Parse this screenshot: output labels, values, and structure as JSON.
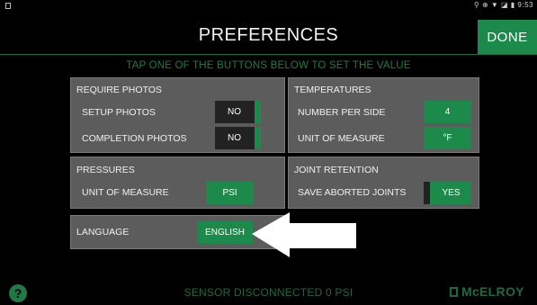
{
  "status_bar": {
    "right_text": "⚲ ⊕ ▼ ◪ ▮ 9:53"
  },
  "header": {
    "title": "PREFERENCES",
    "done_label": "DONE"
  },
  "instruction": "TAP ONE OF THE BUTTONS BELOW TO SET THE VALUE",
  "require_photos": {
    "title": "REQUIRE PHOTOS",
    "setup_label": "SETUP PHOTOS",
    "setup_value": "NO",
    "completion_label": "COMPLETION PHOTOS",
    "completion_value": "NO"
  },
  "temperatures": {
    "title": "TEMPERATURES",
    "number_label": "NUMBER PER SIDE",
    "number_value": "4",
    "unit_label": "UNIT OF MEASURE",
    "unit_value": "°F"
  },
  "pressures": {
    "title": "PRESSURES",
    "unit_label": "UNIT OF MEASURE",
    "unit_value": "PSI"
  },
  "joint_retention": {
    "title": "JOINT RETENTION",
    "save_label": "SAVE ABORTED JOINTS",
    "save_value": "YES"
  },
  "language": {
    "label": "LANGUAGE",
    "value": "ENGLISH"
  },
  "footer": {
    "help_icon_text": "?",
    "status": "SENSOR DISCONNECTED 0 PSI",
    "brand": "McELROY"
  },
  "colors": {
    "accent": "#1b8a4a",
    "panel": "#5c5c5c",
    "background": "#000000"
  },
  "icons": {
    "help": "help-icon",
    "arrow": "arrow-left-icon",
    "brand_mark": "mcelroy-logo-icon"
  }
}
